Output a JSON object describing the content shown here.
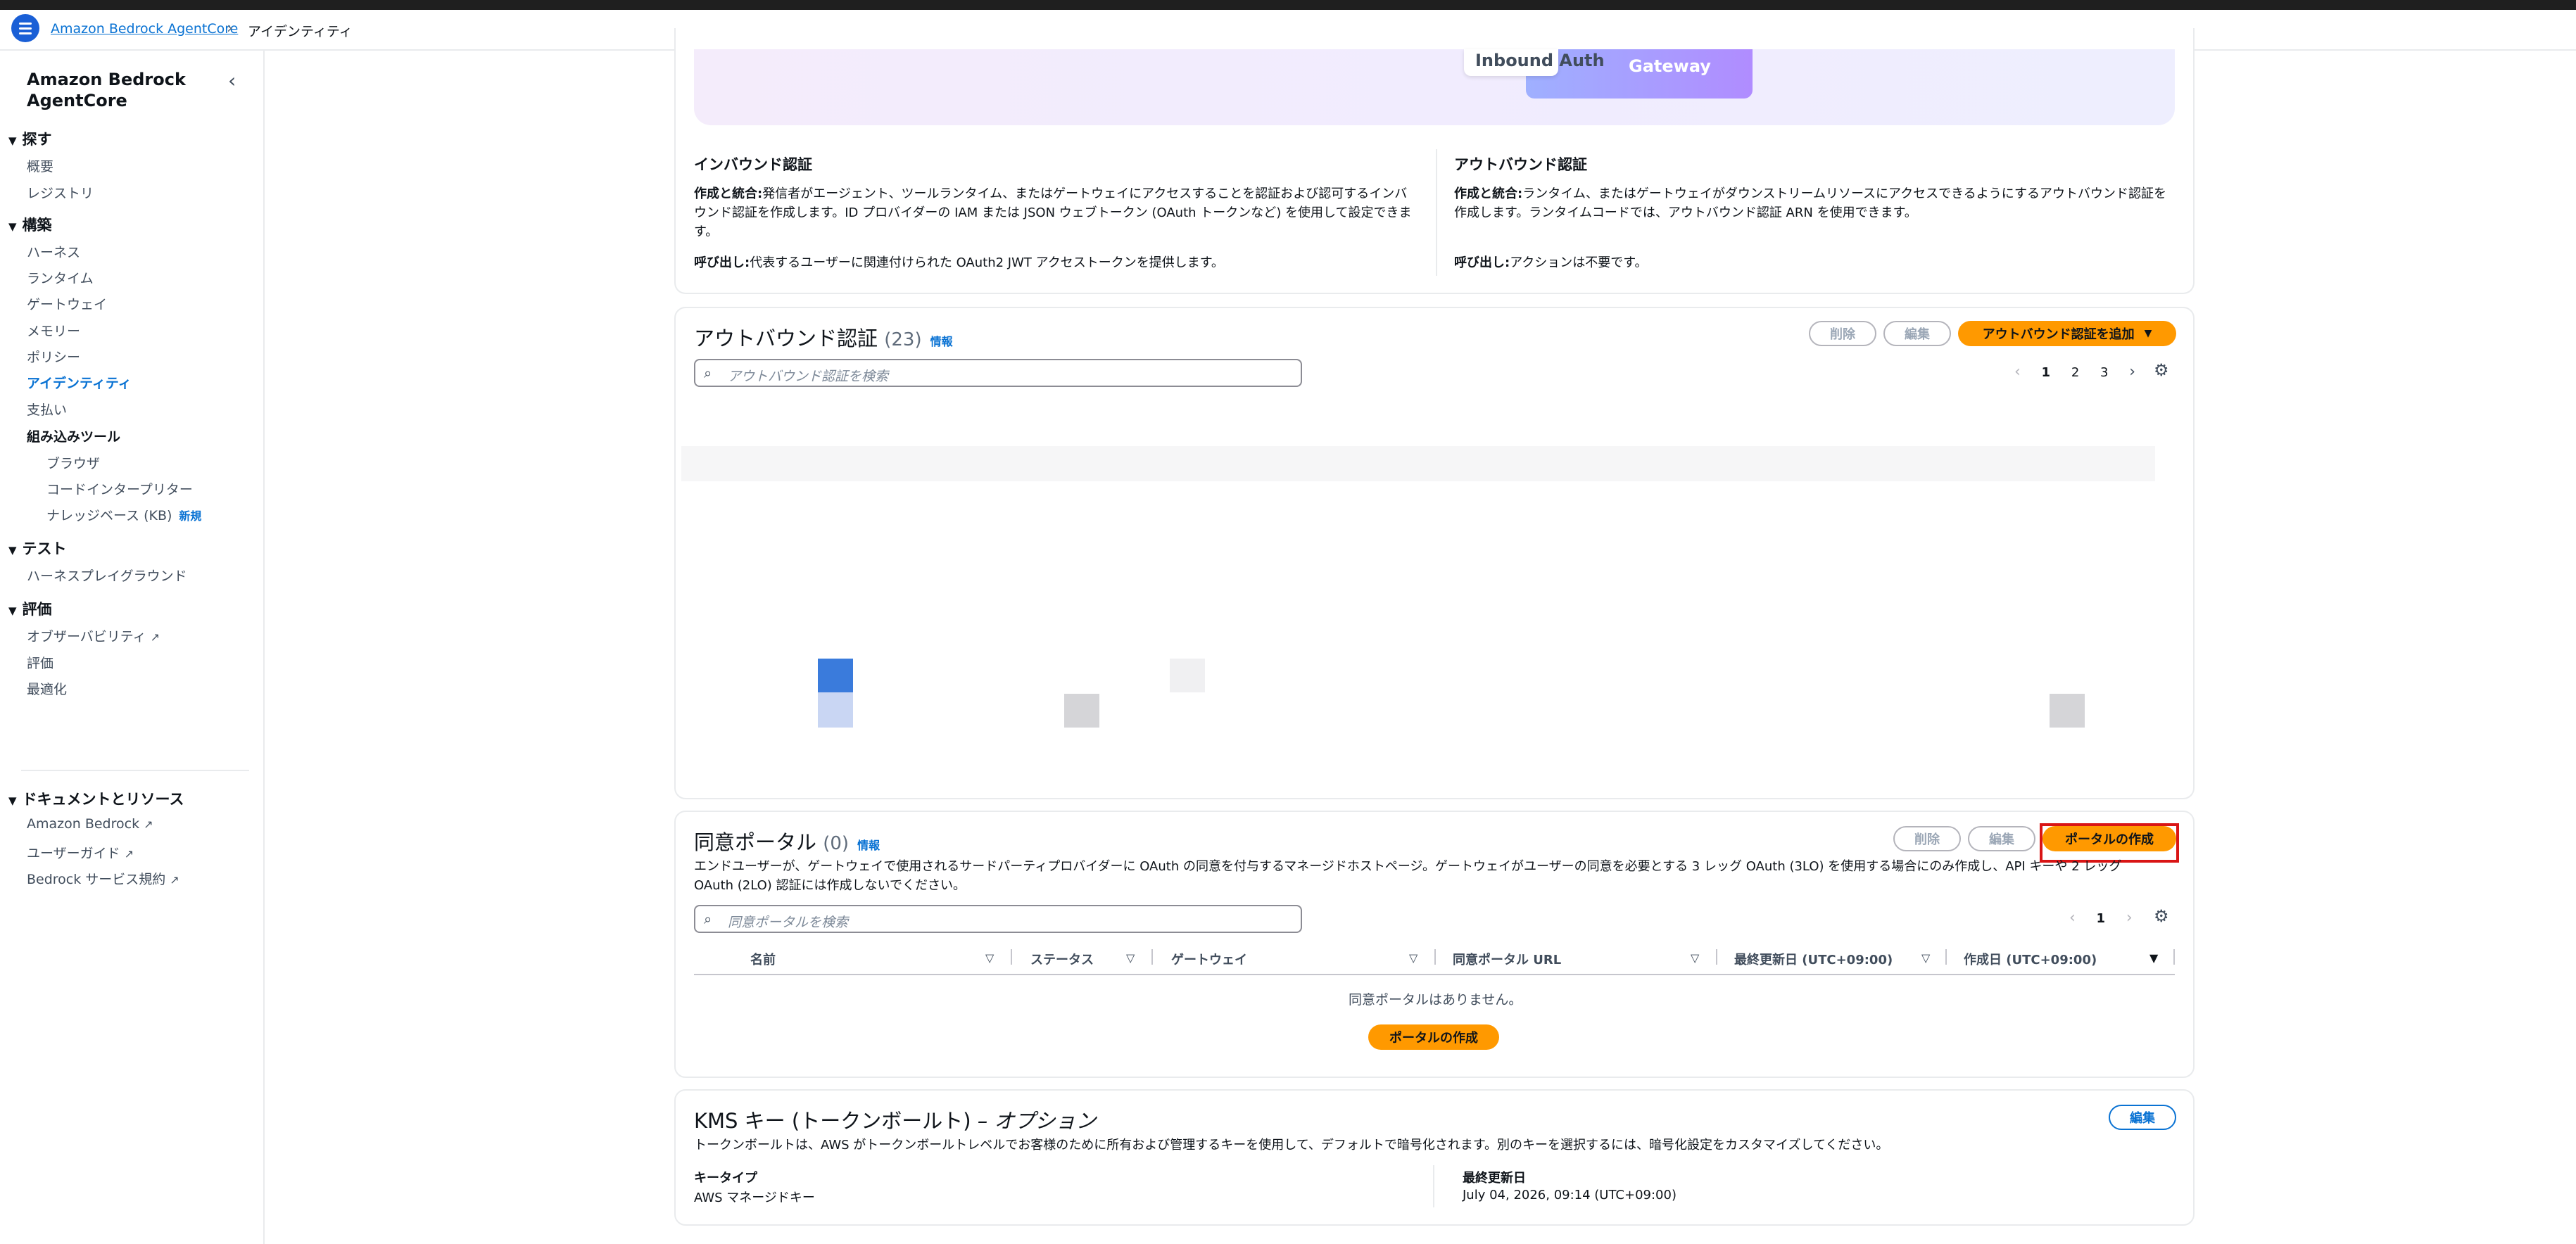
{
  "breadcrumb": {
    "root": "Amazon Bedrock AgentCore",
    "current": "アイデンティティ"
  },
  "sidebar": {
    "title": "Amazon Bedrock AgentCore",
    "sections": {
      "explore": "探す",
      "explore_items": [
        "概要",
        "レジストリ"
      ],
      "build": "構築",
      "build_items": [
        "ハーネス",
        "ランタイム",
        "ゲートウェイ",
        "メモリー",
        "ポリシー",
        "アイデンティティ",
        "支払い"
      ],
      "builtin_tools": "組み込みツール",
      "builtin_items": [
        "ブラウザ",
        "コードインタープリター",
        "ナレッジベース (KB)"
      ],
      "new_badge": "新規",
      "test": "テスト",
      "test_items": [
        "ハーネスプレイグラウンド"
      ],
      "eval": "評価",
      "eval_items": [
        "オブザーバビリティ",
        "評価",
        "最適化"
      ],
      "docs": "ドキュメントとリソース",
      "docs_items": [
        "Amazon Bedrock",
        "ユーザーガイド",
        "Bedrock サービス規約"
      ]
    }
  },
  "diagram": {
    "inbound_auth": "Inbound Auth",
    "gateway": "Gateway"
  },
  "inbound": {
    "heading": "インバウンド認証",
    "create_label": "作成と統合:",
    "create_text": "発信者がエージェント、ツールランタイム、またはゲートウェイにアクセスすることを認証および認可するインバウンド認証を作成します。ID プロバイダーの IAM または JSON ウェブトークン (OAuth トークンなど) を使用して設定できます。",
    "invoke_label": "呼び出し:",
    "invoke_text": "代表するユーザーに関連付けられた OAuth2 JWT アクセストークンを提供します。"
  },
  "outbound_info": {
    "heading": "アウトバウンド認証",
    "create_label": "作成と統合:",
    "create_text": "ランタイム、またはゲートウェイがダウンストリームリソースにアクセスできるようにするアウトバウンド認証を作成します。ランタイムコードでは、アウトバウンド認証 ARN を使用できます。",
    "invoke_label": "呼び出し:",
    "invoke_text": "アクションは不要です。"
  },
  "outbound": {
    "title": "アウトバウンド認証",
    "count": "(23)",
    "info": "情報",
    "delete": "削除",
    "edit": "編集",
    "add": "アウトバウンド認証を追加",
    "search_placeholder": "アウトバウンド認証を検索",
    "pages": [
      "1",
      "2",
      "3"
    ]
  },
  "consent": {
    "title": "同意ポータル",
    "count": "(0)",
    "info": "情報",
    "delete": "削除",
    "edit": "編集",
    "create": "ポータルの作成",
    "description": "エンドユーザーが、ゲートウェイで使用されるサードパーティプロバイダーに OAuth の同意を付与するマネージドホストページ。ゲートウェイがユーザーの同意を必要とする 3 レッグ OAuth (3LO) を使用する場合にのみ作成し、API キーや 2 レッグ OAuth (2LO) 認証には作成しないでください。",
    "search_placeholder": "同意ポータルを検索",
    "page": "1",
    "columns": [
      "名前",
      "ステータス",
      "ゲートウェイ",
      "同意ポータル URL",
      "最終更新日 (UTC+09:00)",
      "作成日 (UTC+09:00)"
    ],
    "empty": "同意ポータルはありません。",
    "empty_create": "ポータルの作成"
  },
  "kms": {
    "title": "KMS キー (トークンボールト)",
    "optional": "– オプション",
    "edit": "編集",
    "description": "トークンボールトは、AWS がトークンボールトレベルでお客様のために所有および管理するキーを使用して、デフォルトで暗号化されます。別のキーを選択するには、暗号化設定をカスタマイズしてください。",
    "key_type_label": "キータイプ",
    "key_type_value": "AWS マネージドキー",
    "updated_label": "最終更新日",
    "updated_value": "July 04, 2026, 09:14 (UTC+09:00)"
  },
  "colors": {
    "accent": "#ff9900",
    "link": "#0972d3",
    "highlight": "#d91515"
  }
}
